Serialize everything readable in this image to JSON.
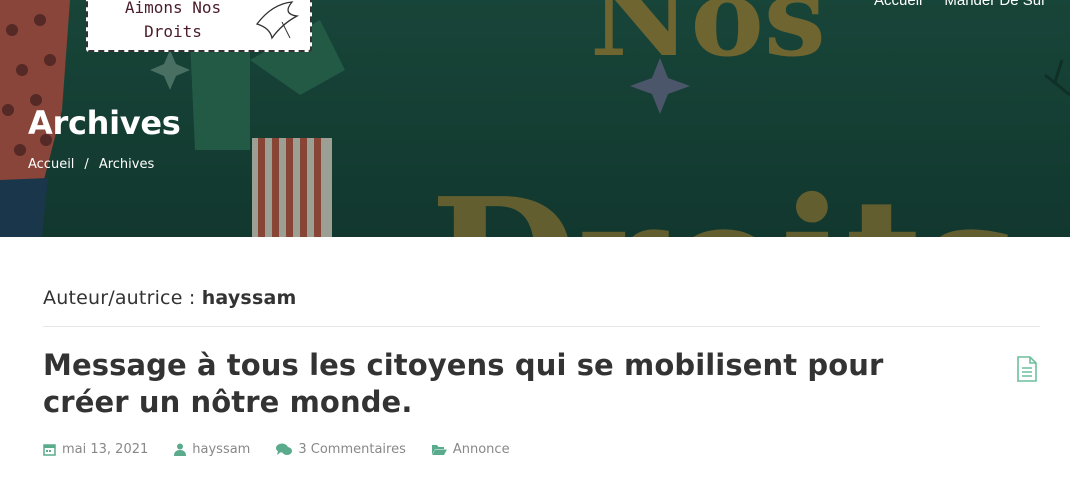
{
  "logo": {
    "text": "Aimons Nos\nDroits"
  },
  "nav": {
    "items": [
      "Accueil",
      "Mander De Sur"
    ]
  },
  "hero": {
    "title": "Archives",
    "breadcrumb": {
      "home": "Accueil",
      "separator": "/",
      "current": "Archives"
    }
  },
  "archive": {
    "label": "Auteur/autrice :",
    "author": "hayssam"
  },
  "post": {
    "title": "Message à tous les citoyens qui se mobilisent pour créer un nôtre monde.",
    "date": "mai 13, 2021",
    "author": "hayssam",
    "comments": "3 Commentaires",
    "category": "Annonce",
    "format_icon": "document-icon"
  },
  "colors": {
    "accent": "#5aab8c",
    "hero_bg": "#1d4a3e",
    "text": "#333333",
    "meta": "#888888"
  }
}
